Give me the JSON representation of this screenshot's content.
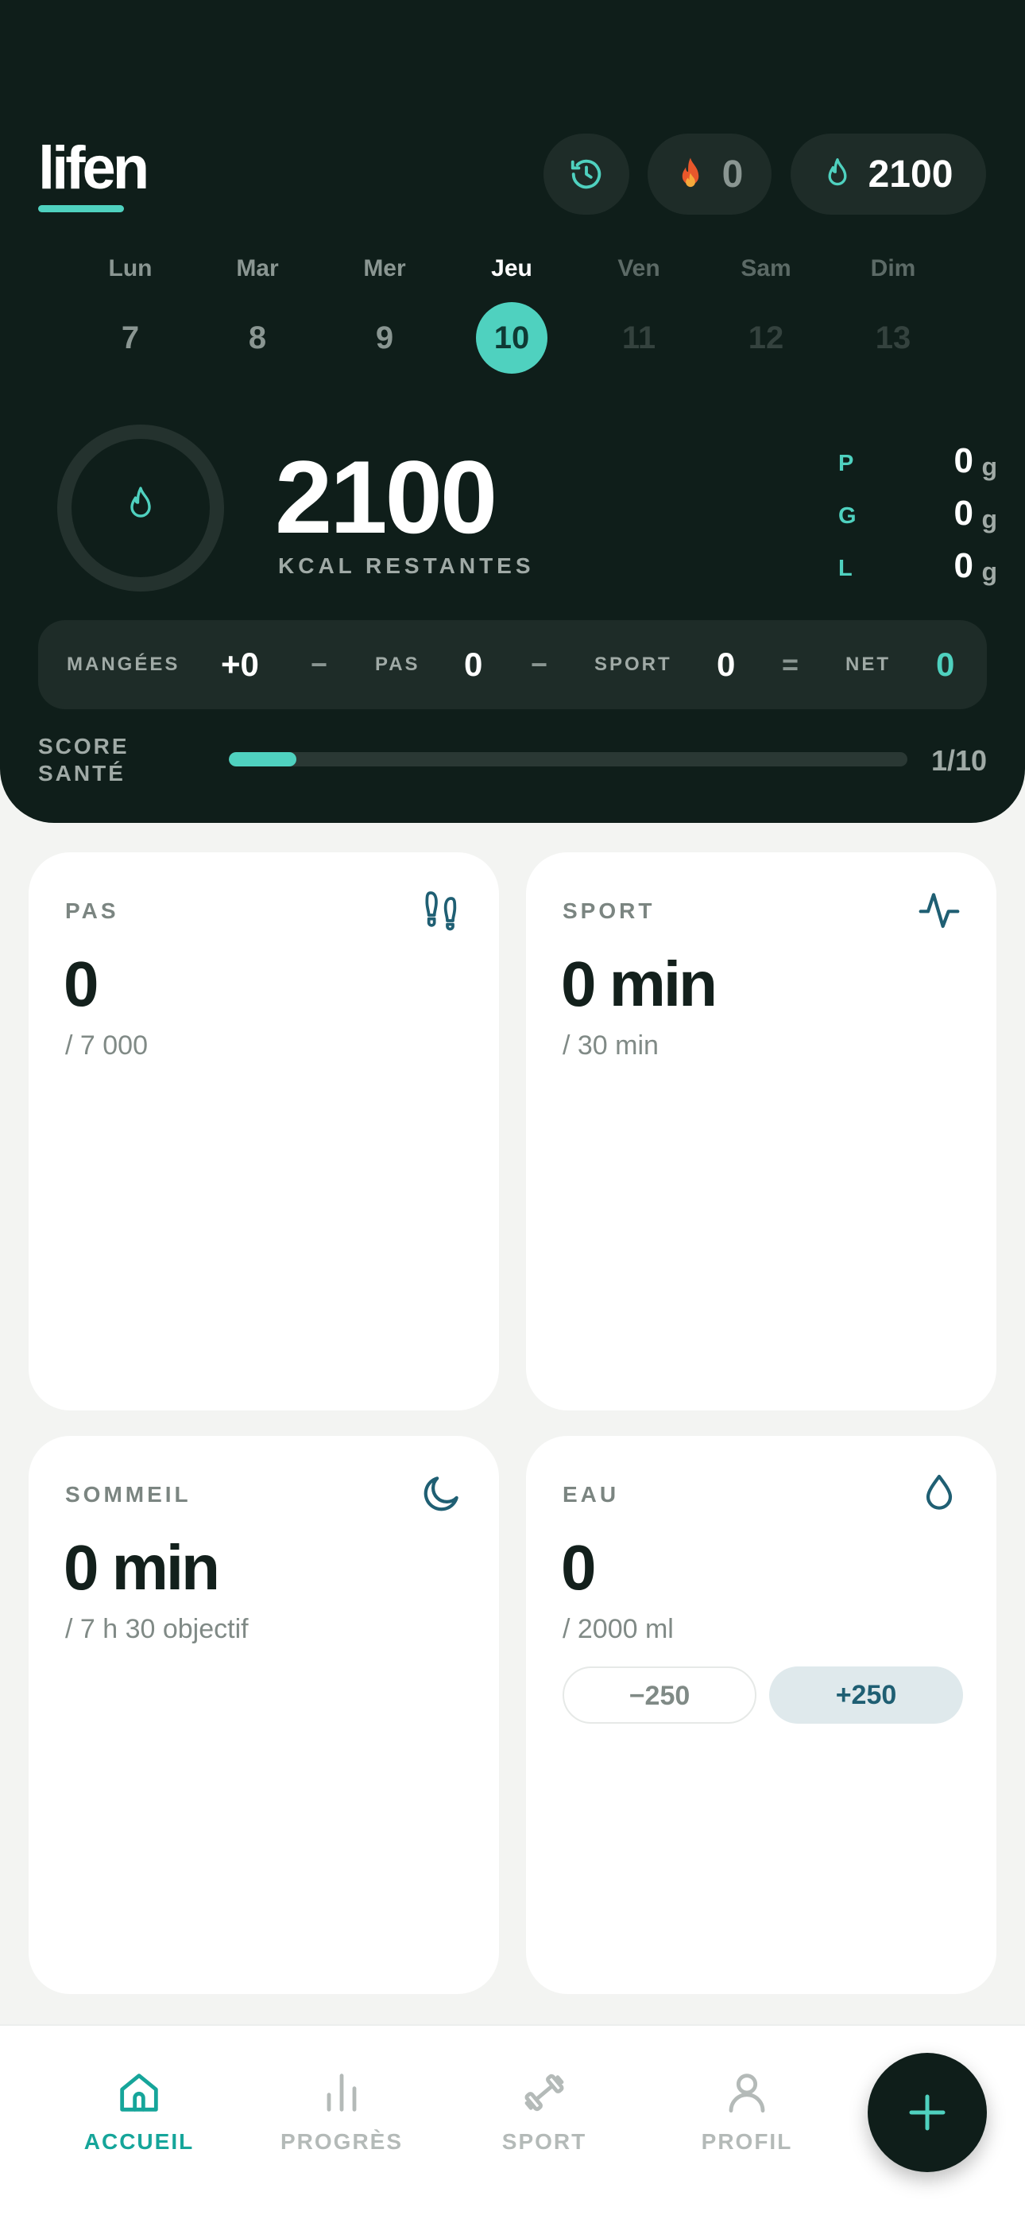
{
  "app": {
    "logo": "lifen"
  },
  "header": {
    "streak_value": "0",
    "goal_value": "2100"
  },
  "week": [
    {
      "name": "Lun",
      "num": "7",
      "state": "past"
    },
    {
      "name": "Mar",
      "num": "8",
      "state": "past"
    },
    {
      "name": "Mer",
      "num": "9",
      "state": "past"
    },
    {
      "name": "Jeu",
      "num": "10",
      "state": "active"
    },
    {
      "name": "Ven",
      "num": "11",
      "state": "future"
    },
    {
      "name": "Sam",
      "num": "12",
      "state": "future"
    },
    {
      "name": "Dim",
      "num": "13",
      "state": "future"
    }
  ],
  "summary": {
    "kcal_remaining": "2100",
    "kcal_label": "KCAL RESTANTES",
    "ring_progress": 0,
    "macros": [
      {
        "letter": "P",
        "value": "0",
        "unit": "g"
      },
      {
        "letter": "G",
        "value": "0",
        "unit": "g"
      },
      {
        "letter": "L",
        "value": "0",
        "unit": "g"
      }
    ]
  },
  "equation": {
    "eaten_label": "MANGÉES",
    "eaten_value": "+0",
    "minus1": "−",
    "steps_label": "PAS",
    "steps_value": "0",
    "minus2": "−",
    "sport_label": "SPORT",
    "sport_value": "0",
    "equals": "=",
    "net_label": "NET",
    "net_value": "0"
  },
  "score": {
    "label_line1": "SCORE",
    "label_line2": "SANTÉ",
    "value": "1/10",
    "progress": 0.1
  },
  "cards": {
    "steps": {
      "title": "PAS",
      "value": "0",
      "target": "/ 7 000"
    },
    "sport": {
      "title": "SPORT",
      "value": "0 min",
      "target": "/ 30 min"
    },
    "sleep": {
      "title": "SOMMEIL",
      "value": "0 min",
      "target": "/ 7 h 30 objectif"
    },
    "water": {
      "title": "EAU",
      "value": "0",
      "target": "/ 2000 ml",
      "minus_label": "−250",
      "plus_label": "+250"
    }
  },
  "nav": {
    "items": [
      {
        "label": "ACCUEIL",
        "icon": "home-icon",
        "active": true
      },
      {
        "label": "PROGRÈS",
        "icon": "bar-chart-icon",
        "active": false
      },
      {
        "label": "SPORT",
        "icon": "dumbbell-icon",
        "active": false
      },
      {
        "label": "PROFIL",
        "icon": "user-icon",
        "active": false
      }
    ],
    "fab_icon": "plus-icon"
  },
  "colors": {
    "hero_bg": "#0f1e1a",
    "accent": "#4fd1bf",
    "accent_dark": "#16a59a",
    "card_icon": "#1f5f73"
  }
}
